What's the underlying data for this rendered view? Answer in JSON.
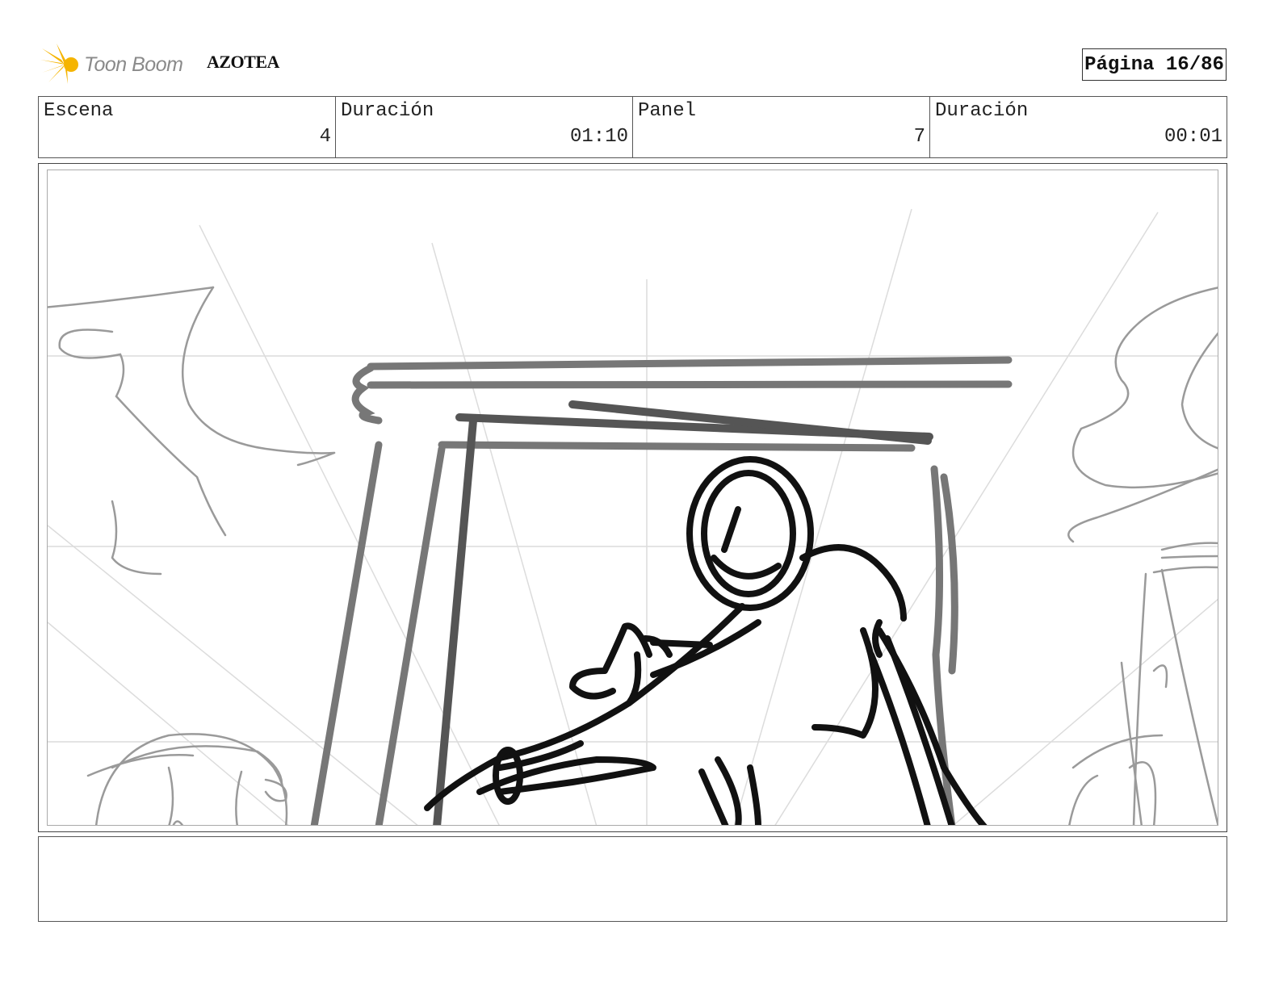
{
  "header": {
    "logo_text": "Toon Boom",
    "project_title": "AZOTEA",
    "page_label": "Página 16/86"
  },
  "info": [
    {
      "label": "Escena",
      "value": "4"
    },
    {
      "label": "Duración",
      "value": "01:10"
    },
    {
      "label": "Panel",
      "value": "7"
    },
    {
      "label": "Duración",
      "value": "00:01"
    }
  ],
  "panel": {
    "description": "Rough storyboard sketch of a character leaning forward inside a doorway frame, reaching with one arm; clouds in the background",
    "colors": {
      "ink": "#111111",
      "mid_ink": "#777777",
      "light_ink": "#9a9a9a",
      "guide": "#dddddd"
    }
  },
  "dialogue": {
    "text": ""
  },
  "colors": {
    "accent": "#f5b400",
    "logo_text": "#8a8a8a",
    "border": "#555555"
  }
}
